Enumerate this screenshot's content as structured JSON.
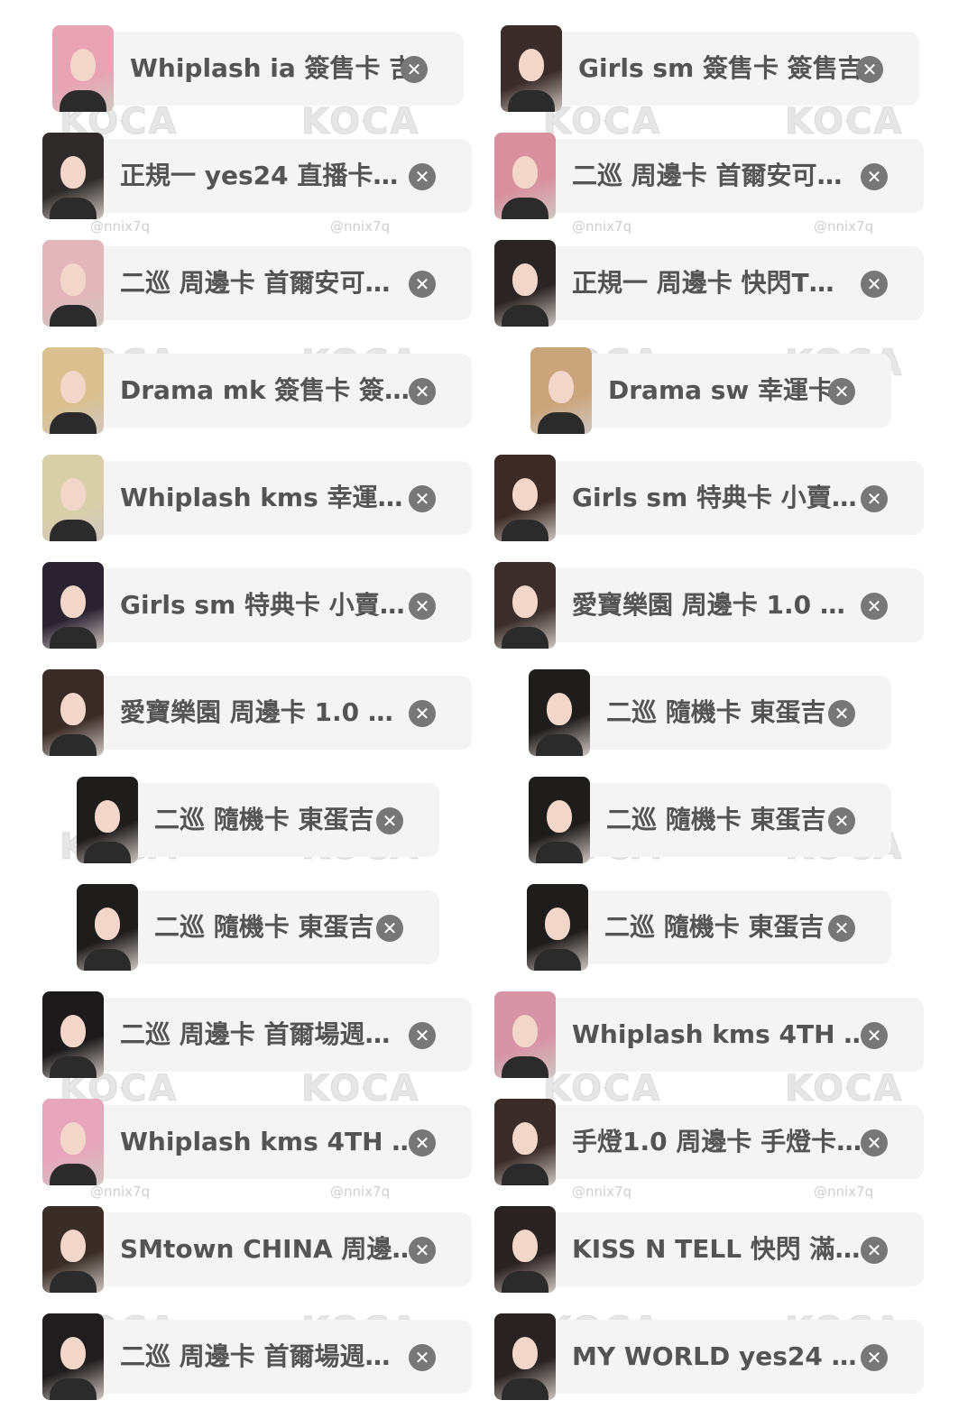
{
  "colors": {
    "chip_background": "#f4f4f4",
    "label_text": "#545454",
    "remove_button": "#777777",
    "watermark": "#d2d2d2"
  },
  "watermarks": {
    "logo": "KOCA",
    "handle": "@nnix7q"
  },
  "icons": {
    "remove": "close-circle-icon"
  },
  "tags": [
    {
      "label": "Whiplash ia 簽售卡 吉",
      "hair": "#e8a3b4"
    },
    {
      "label": "Girls sm 簽售卡 簽售吉",
      "hair": "#3a2c2a"
    },
    {
      "label": "正規一 yes24 直播卡…",
      "hair": "#2e2b2a"
    },
    {
      "label": "二巡 周邊卡 首爾安可…",
      "hair": "#d8909f"
    },
    {
      "label": "二巡 周邊卡 首爾安可…",
      "hair": "#e2b6ba"
    },
    {
      "label": "正規一 周邊卡 快閃T…",
      "hair": "#2a2424"
    },
    {
      "label": "Drama mk 簽售卡 簽…",
      "hair": "#d9c08e"
    },
    {
      "label": "Drama sw 幸運卡",
      "hair": "#caa47a"
    },
    {
      "label": "Whiplash kms 幸運…",
      "hair": "#d8cfa8"
    },
    {
      "label": "Girls sm 特典卡 小賣…",
      "hair": "#3b2a25"
    },
    {
      "label": "Girls sm 特典卡 小賣…",
      "hair": "#2a2230"
    },
    {
      "label": "愛寶樂園 周邊卡 1.0 …",
      "hair": "#3a2d2a"
    },
    {
      "label": "愛寶樂園 周邊卡 1.0 …",
      "hair": "#3b2b27"
    },
    {
      "label": "二巡 隨機卡 東蛋吉",
      "hair": "#1f1c1c"
    },
    {
      "label": "二巡 隨機卡 東蛋吉",
      "hair": "#1f1c1c"
    },
    {
      "label": "二巡 隨機卡 東蛋吉",
      "hair": "#1f1c1c"
    },
    {
      "label": "二巡 隨機卡 東蛋吉",
      "hair": "#1f1c1c"
    },
    {
      "label": "二巡 隨機卡 東蛋吉",
      "hair": "#1f1c1c"
    },
    {
      "label": "二巡 周邊卡 首爾場週…",
      "hair": "#1c1a1b"
    },
    {
      "label": "Whiplash kms 4TH …",
      "hair": "#d694a6"
    },
    {
      "label": "Whiplash kms 4TH …",
      "hair": "#e7a6bc"
    },
    {
      "label": "手燈1.0 周邊卡 手燈卡…",
      "hair": "#3a2c28"
    },
    {
      "label": "SMtown CHINA 周邊…",
      "hair": "#3a2d28"
    },
    {
      "label": "KISS N TELL 快閃 滿…",
      "hair": "#2b2222"
    },
    {
      "label": "二巡 周邊卡 首爾場週…",
      "hair": "#211d1e"
    },
    {
      "label": "MY WORLD yes24 …",
      "hair": "#2a2322"
    }
  ]
}
